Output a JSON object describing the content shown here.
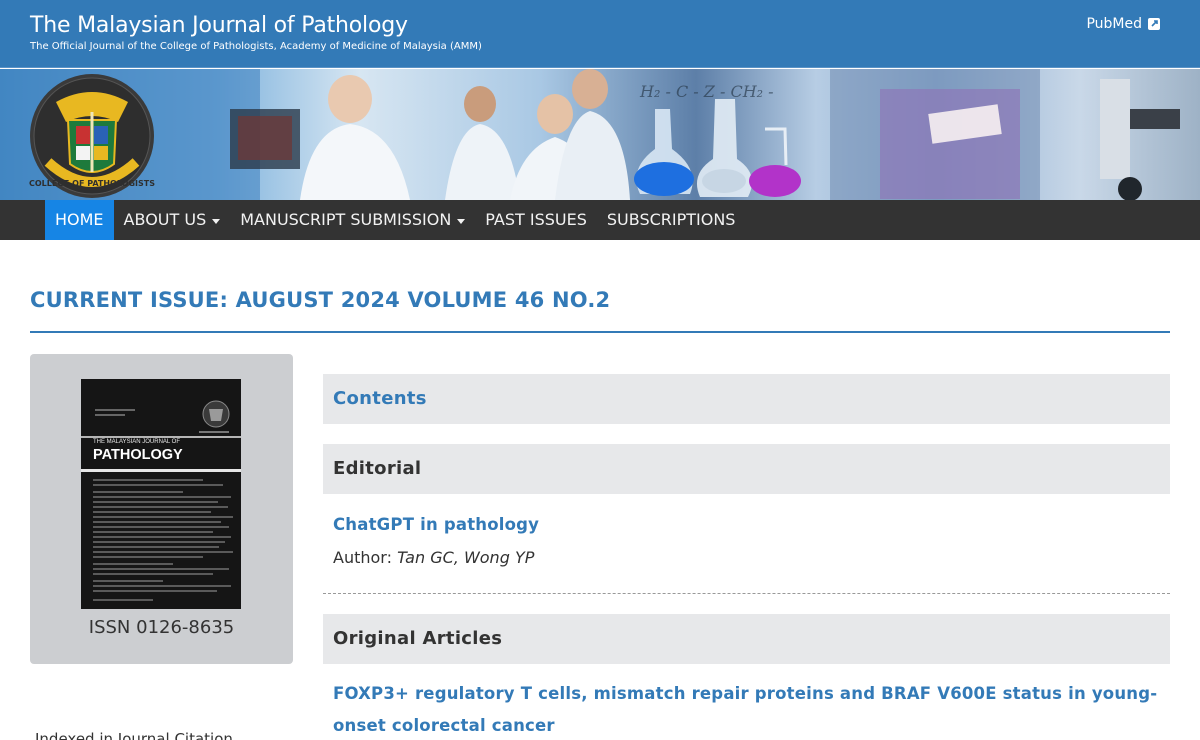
{
  "header": {
    "title": "The Malaysian Journal of Pathology",
    "subtitle": "The Official Journal of the College of Pathologists, Academy of Medicine of Malaysia (AMM)",
    "pubmed_label": "PubMed",
    "brand_color": "#337ab7"
  },
  "logo": {
    "ring_text": "COLLEGE OF PATHOLOGISTS"
  },
  "nav": {
    "items": [
      {
        "label": "HOME",
        "active": true,
        "dropdown": false
      },
      {
        "label": "ABOUT US",
        "active": false,
        "dropdown": true
      },
      {
        "label": "MANUSCRIPT SUBMISSION",
        "active": false,
        "dropdown": true
      },
      {
        "label": "PAST ISSUES",
        "active": false,
        "dropdown": false
      },
      {
        "label": "SUBSCRIPTIONS",
        "active": false,
        "dropdown": false
      }
    ],
    "active_color": "#1685e5"
  },
  "issue": {
    "heading": "CURRENT ISSUE: AUGUST 2024 VOLUME 46 NO.2"
  },
  "cover": {
    "title_small": "THE MALAYSIAN JOURNAL OF",
    "title_large": "PATHOLOGY",
    "issn": "ISSN 0126-8635"
  },
  "sidebar": {
    "indexed_text": "Indexed in Journal Citation"
  },
  "contents": {
    "heading": "Contents",
    "sections": [
      {
        "heading": "Editorial",
        "articles": [
          {
            "title": "ChatGPT in pathology",
            "author_label": "Author:",
            "authors": "Tan GC, Wong YP"
          }
        ]
      },
      {
        "heading": "Original Articles",
        "articles": [
          {
            "title_line1": "FOXP3+ regulatory T cells, mismatch repair proteins and BRAF V600E status in young-",
            "title_line2": "onset colorectal cancer"
          }
        ]
      }
    ]
  }
}
